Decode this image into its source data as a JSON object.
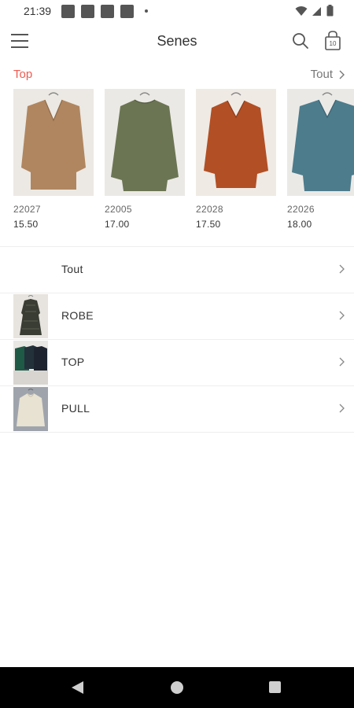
{
  "status_bar": {
    "time": "21:39",
    "notification_icons": [
      "notification-icon",
      "notification-icon",
      "notification-icon",
      "notification-icon"
    ],
    "icons": [
      "wifi-icon",
      "signal-icon",
      "battery-icon"
    ]
  },
  "app_bar": {
    "title": "Senes",
    "menu_icon": "menu-icon",
    "search_icon": "search-icon",
    "cart_icon": "shopping-bag-icon",
    "cart_count": "10"
  },
  "top_section": {
    "title": "Top",
    "see_all": "Tout",
    "title_color": "#ef5b52",
    "products": [
      {
        "ref": "22027",
        "price": "15.50",
        "color": "#b08660"
      },
      {
        "ref": "22005",
        "price": "17.00",
        "color": "#6b7553"
      },
      {
        "ref": "22028",
        "price": "17.50",
        "color": "#b24f25"
      },
      {
        "ref": "22026",
        "price": "18.00",
        "color": "#4d7c8c"
      }
    ]
  },
  "categories": [
    {
      "label": "Tout",
      "has_image": false
    },
    {
      "label": "ROBE",
      "has_image": true
    },
    {
      "label": "TOP",
      "has_image": true
    },
    {
      "label": "PULL",
      "has_image": true
    }
  ]
}
